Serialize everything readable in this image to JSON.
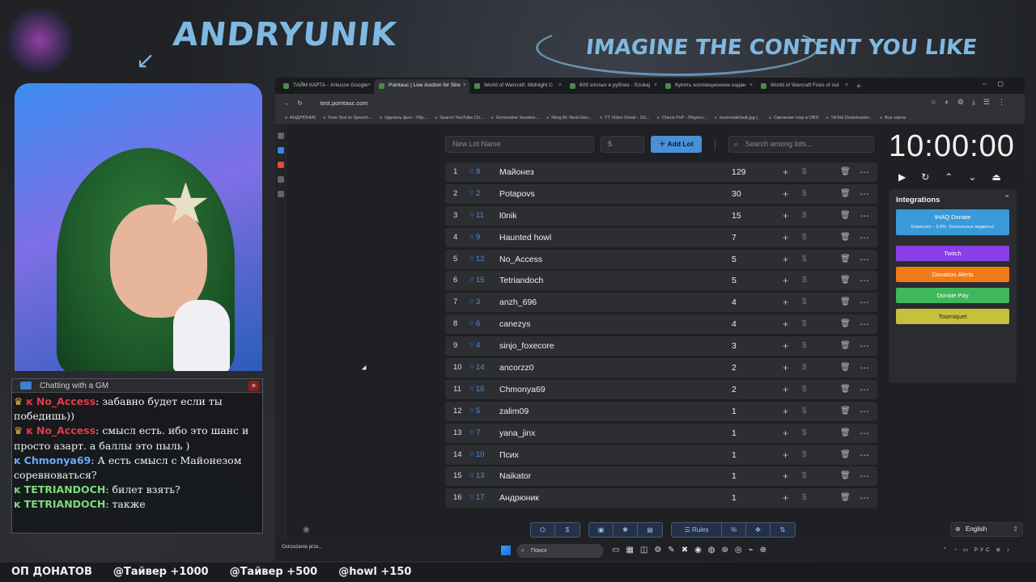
{
  "overlay": {
    "streamer_name": "ANDRYUNIK",
    "tagline": "IMAGINE THE CONTENT YOU LIKE"
  },
  "chat": {
    "title": "Chatting with a GM",
    "close": "×",
    "messages": [
      {
        "nick": "No_Access",
        "nick_color": "#e03a4a",
        "badge": "crown",
        "text": ": забавно будет если ты победишь))"
      },
      {
        "nick": "No_Access",
        "nick_color": "#e03a4a",
        "badge": "crown",
        "text": ": смысл есть. ибо это шанс и просто азарт. а баллы это пыль )"
      },
      {
        "nick": "Chmonya69",
        "nick_color": "#6aa9ff",
        "badge": "k",
        "text": ": А есть смысл с Майонезом соревноваться?"
      },
      {
        "nick": "TETRIANDOCH",
        "nick_color": "#7ddc7a",
        "badge": "k",
        "text": ": билет взять?"
      },
      {
        "nick": "TETRIANDOCH",
        "nick_color": "#7ddc7a",
        "badge": "k",
        "text": ": также"
      }
    ]
  },
  "browser": {
    "tabs": [
      {
        "label": "ТАЙМ КАРТА - Arkusze Google",
        "active": false
      },
      {
        "label": "Pointauc | Live Auction for Stre",
        "active": true
      },
      {
        "label": "World of Warcraft: Midnight C",
        "active": false
      },
      {
        "label": "609 злотых в рублях - Szukaj",
        "active": false
      },
      {
        "label": "Купить коллекционное издан",
        "active": false
      },
      {
        "label": "World of Warcraft Fires of out",
        "active": false
      }
    ],
    "url": "test.pointauc.com",
    "bookmarks": [
      "АНДРЮНИК",
      "Free Text to Speech...",
      "Удалить фон - Убр...",
      "Search YouTube Ch...",
      "Generative Session...",
      "Kling AI: Next-Gen...",
      "YT Video Detail - SS...",
      "Check PvP - Players...",
      "maxresdefault.jpg (...",
      "Свечение глаз в OBS",
      "TikTok Downloader...",
      "Все закла"
    ]
  },
  "auction": {
    "new_lot_placeholder": "New Lot Name",
    "amount_placeholder": "$",
    "add_lot_label": "Add Lot",
    "search_placeholder": "Search among lots...",
    "lots": [
      {
        "idx": "1",
        "fast_id": "8",
        "name": "Майонез",
        "amount": "129"
      },
      {
        "idx": "2",
        "fast_id": "2",
        "name": "Potapovs",
        "amount": "30"
      },
      {
        "idx": "3",
        "fast_id": "11",
        "name": "l0nik",
        "amount": "15"
      },
      {
        "idx": "4",
        "fast_id": "9",
        "name": "Haunted howl",
        "amount": "7"
      },
      {
        "idx": "5",
        "fast_id": "12",
        "name": "No_Access",
        "amount": "5"
      },
      {
        "idx": "6",
        "fast_id": "15",
        "name": "Tetriandoch",
        "amount": "5"
      },
      {
        "idx": "7",
        "fast_id": "3",
        "name": "anzh_696",
        "amount": "4"
      },
      {
        "idx": "8",
        "fast_id": "6",
        "name": "canezys",
        "amount": "4"
      },
      {
        "idx": "9",
        "fast_id": "4",
        "name": "sinjo_foxecore",
        "amount": "3"
      },
      {
        "idx": "10",
        "fast_id": "14",
        "name": "ancorzz0",
        "amount": "2"
      },
      {
        "idx": "11",
        "fast_id": "16",
        "name": "Chmonya69",
        "amount": "2"
      },
      {
        "idx": "12",
        "fast_id": "5",
        "name": "zalim09",
        "amount": "1"
      },
      {
        "idx": "13",
        "fast_id": "7",
        "name": "yana_jinx",
        "amount": "1"
      },
      {
        "idx": "14",
        "fast_id": "10",
        "name": "Псих",
        "amount": "1"
      },
      {
        "idx": "15",
        "fast_id": "13",
        "name": "Naikator",
        "amount": "1"
      },
      {
        "idx": "16",
        "fast_id": "17",
        "name": "Андрюник",
        "amount": "1"
      }
    ],
    "timer": "10:00:00",
    "integrations": {
      "title": "Integrations",
      "donate_label": "IHAQ Donate",
      "donate_sub": "Комиссия – 3,5%. Уникальные виджеты!",
      "twitch_label": "Twitch",
      "alerts_label": "Donation Alerts",
      "pay_label": "Donate Pay",
      "tourniquet_label": "Tourniquet"
    },
    "toolbar_rules_label": "Rules",
    "language": "English"
  },
  "taskbar": {
    "notification": "Ostrzeżenie prze...",
    "search_placeholder": "Поиск",
    "lang": "РУС"
  },
  "ticker": {
    "items": [
      "ОП ДОНАТОВ",
      "@Тайвер +1000",
      "@Тайвер +500",
      "@howl +150"
    ]
  },
  "colors": {
    "accent": "#4a90d9",
    "twitch": "#8a3fe8",
    "donation_alerts": "#f07a18",
    "donate_pay": "#3fb85c",
    "tourniquet": "#c6c03a"
  }
}
